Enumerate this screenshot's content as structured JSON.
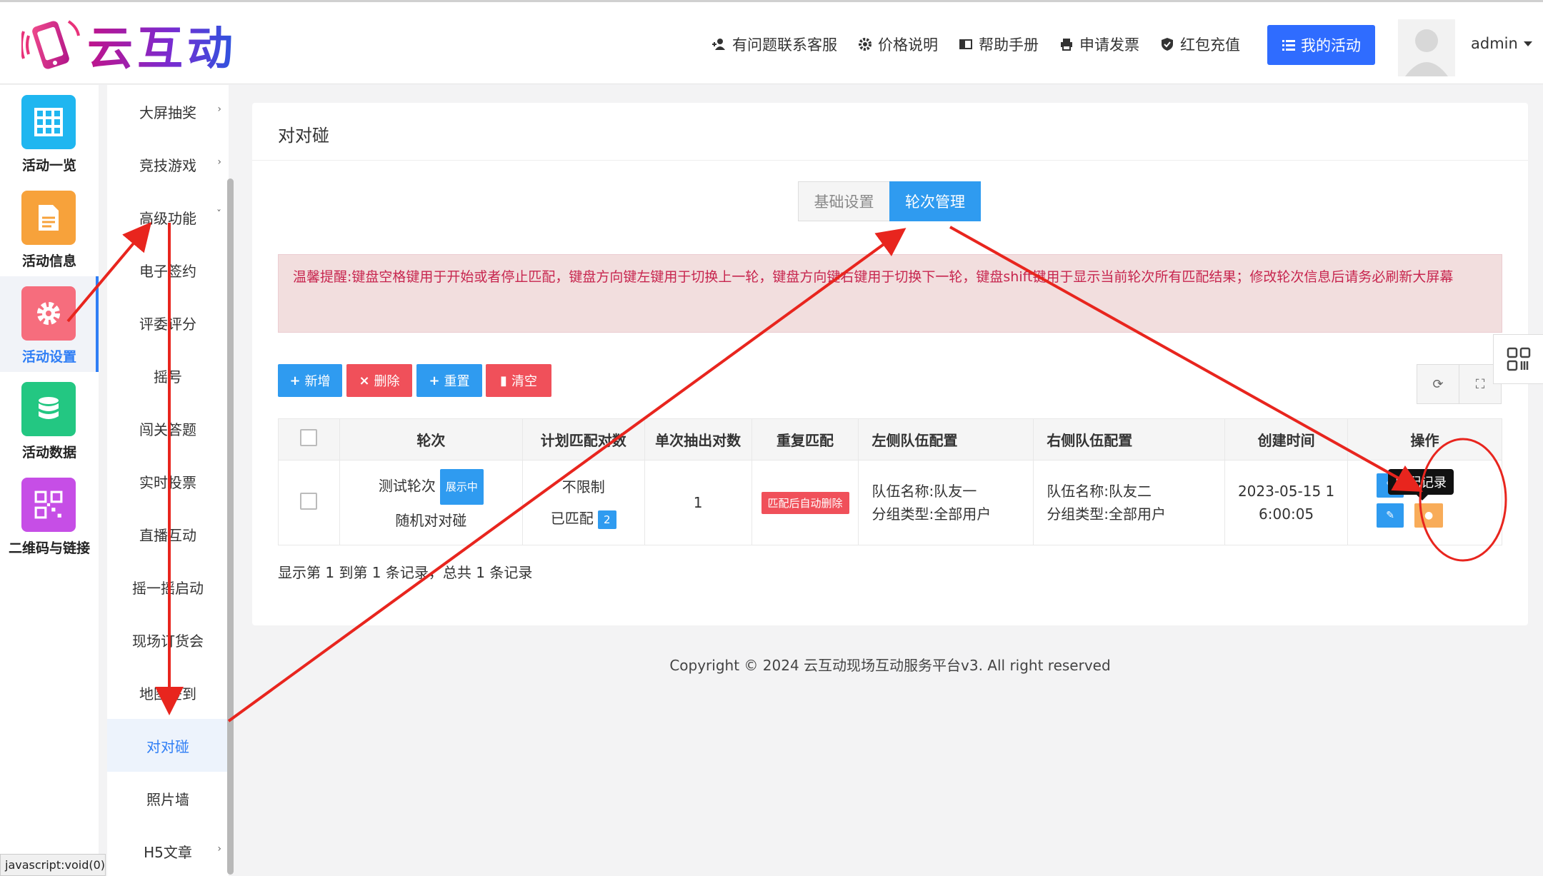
{
  "brand": {
    "name": "云互动"
  },
  "top_nav": [
    {
      "label": "有问题联系客服",
      "icon": "user-plus-icon"
    },
    {
      "label": "价格说明",
      "icon": "gear-icon"
    },
    {
      "label": "帮助手册",
      "icon": "book-icon"
    },
    {
      "label": "申请发票",
      "icon": "printer-icon"
    },
    {
      "label": "红包充值",
      "icon": "shield-check-icon"
    }
  ],
  "my_activity": "我的活动",
  "user": {
    "name": "admin"
  },
  "side_icons": [
    {
      "label": "活动一览",
      "color": "#1fb6f0",
      "icon": "grid-icon"
    },
    {
      "label": "活动信息",
      "color": "#f7a23b",
      "icon": "document-icon"
    },
    {
      "label": "活动设置",
      "color": "#f66d7d",
      "icon": "gear-icon",
      "active": true
    },
    {
      "label": "活动数据",
      "color": "#23c782",
      "icon": "database-icon"
    },
    {
      "label": "二维码与链接",
      "color": "#c64ee6",
      "icon": "qrcode-icon"
    }
  ],
  "sub_menu": [
    {
      "label": "大屏抽奖",
      "chevron": "›"
    },
    {
      "label": "竞技游戏",
      "chevron": "›"
    },
    {
      "label": "高级功能",
      "chevron": "ˇ"
    },
    {
      "label": "电子签约"
    },
    {
      "label": "评委评分"
    },
    {
      "label": "摇号"
    },
    {
      "label": "闯关答题"
    },
    {
      "label": "实时投票"
    },
    {
      "label": "直播互动"
    },
    {
      "label": "摇一摇启动"
    },
    {
      "label": "现场订货会"
    },
    {
      "label": "地图签到"
    },
    {
      "label": "对对碰",
      "active": true
    },
    {
      "label": "照片墙"
    },
    {
      "label": "H5文章",
      "chevron": "›"
    }
  ],
  "page": {
    "title": "对对碰",
    "tabs": [
      "基础设置",
      "轮次管理"
    ],
    "active_tab": "轮次管理",
    "alert": "温馨提醒:键盘空格键用于开始或者停止匹配，键盘方向键左键用于切换上一轮，键盘方向键右键用于切换下一轮，键盘shift键用于显示当前轮次所有匹配结果；修改轮次信息后请务必刷新大屏幕",
    "toolbar": {
      "add": "新增",
      "delete": "删除",
      "reset": "重置",
      "clear": "清空"
    }
  },
  "table": {
    "headers": [
      "轮次",
      "计划匹配对数",
      "单次抽出对数",
      "重复匹配",
      "左侧队伍配置",
      "右侧队伍配置",
      "创建时间",
      "操作"
    ],
    "rows": [
      {
        "round_name": "测试轮次",
        "round_badge": "展示中",
        "round_mode": "随机对对碰",
        "plan_pairs": "不限制",
        "matched_label": "已匹配",
        "matched_count": "2",
        "single_pairs": "1",
        "repeat_match": "匹配后自动删除",
        "left_team": "队伍名称:队友一",
        "left_group": "分组类型:全部用户",
        "right_team": "队伍名称:队友二",
        "right_group": "分组类型:全部用户",
        "created_line1": "2023-05-15 1",
        "created_line2": "6:00:05",
        "tooltip": "匹配记录"
      }
    ]
  },
  "record_info": "显示第 1 到第 1 条记录，总共 1 条记录",
  "footer": "Copyright © 2024 云互动现场互动服务平台v3. All right reserved",
  "status_bar": "javascript:void(0)",
  "colors": {
    "primary": "#2f9bf0",
    "danger": "#f0505a",
    "warning": "#f8ac59",
    "annotation": "#e8251e"
  }
}
